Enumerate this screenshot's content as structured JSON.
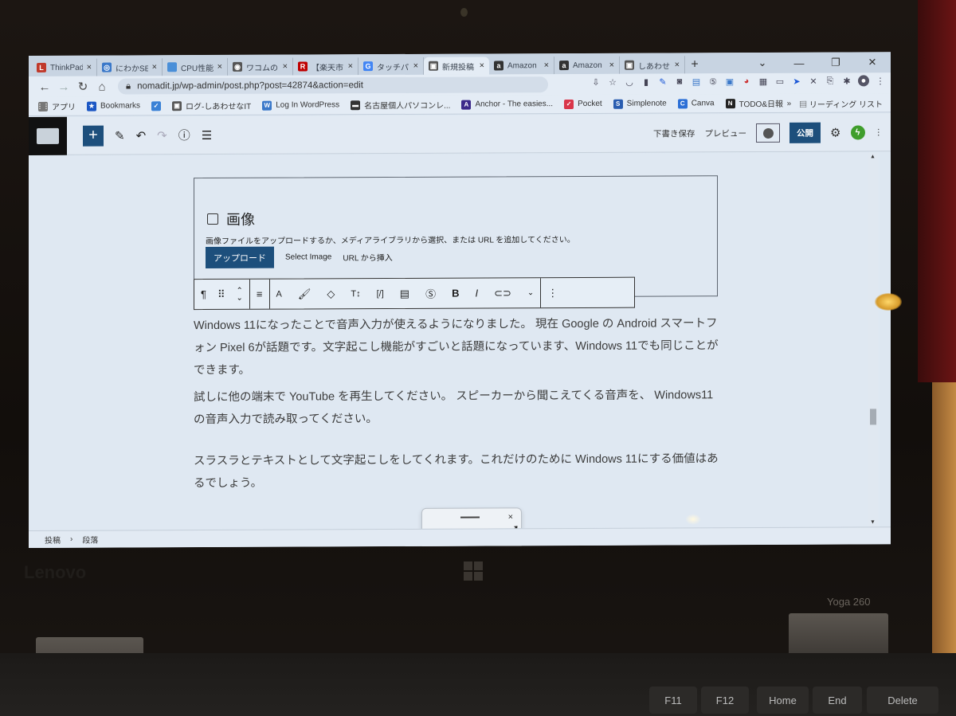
{
  "browser": {
    "tabs": [
      {
        "label": "ThinkPad",
        "icon": "lenovo-icon",
        "color": "#c0392b",
        "glyph": "L"
      },
      {
        "label": "にわかSE",
        "icon": "cloud-icon",
        "color": "#3a78c9",
        "glyph": "◎"
      },
      {
        "label": "CPU性能",
        "icon": "page-icon",
        "color": "#4a8fd8",
        "glyph": ""
      },
      {
        "label": "ワコムのア",
        "icon": "globe-icon",
        "color": "#555",
        "glyph": "◉"
      },
      {
        "label": "【楽天市",
        "icon": "rakuten-icon",
        "color": "#bf0000",
        "glyph": "R"
      },
      {
        "label": "タッチパッ",
        "icon": "google-icon",
        "color": "#4285f4",
        "glyph": "G"
      },
      {
        "label": "新規投稿",
        "icon": "site-icon",
        "color": "#555",
        "glyph": "▣",
        "active": true
      },
      {
        "label": "Amazon",
        "icon": "amazon-icon",
        "color": "#333",
        "glyph": "a"
      },
      {
        "label": "Amazon",
        "icon": "amazon-icon",
        "color": "#333",
        "glyph": "a"
      },
      {
        "label": "しあわせ",
        "icon": "site-icon",
        "color": "#555",
        "glyph": "▣"
      }
    ],
    "tab_close": "×",
    "new_tab": "+",
    "window_controls": [
      "⌄",
      "—",
      "❐",
      "✕"
    ],
    "url": "nomadit.jp/wp-admin/post.php?post=42874&action=edit",
    "bookmarks": [
      {
        "label": "アプリ",
        "icon": "apps-icon",
        "color": "#777",
        "glyph": "⋮⋮"
      },
      {
        "label": "Bookmarks",
        "icon": "star-icon",
        "color": "#1a56c4",
        "glyph": "★"
      },
      {
        "label": "",
        "icon": "twitter-icon",
        "color": "#3b82d6",
        "glyph": "✓"
      },
      {
        "label": "ログ-しあわせなIT",
        "icon": "site-icon",
        "color": "#555",
        "glyph": "▣"
      },
      {
        "label": "Log In WordPress",
        "icon": "wordpress-icon",
        "color": "#3a78c9",
        "glyph": "W"
      },
      {
        "label": "名古屋個人パソコンレ...",
        "icon": "monitor-icon",
        "color": "#333",
        "glyph": "▬"
      },
      {
        "label": "Anchor - The easies...",
        "icon": "anchor-icon",
        "color": "#3d2a8a",
        "glyph": "A"
      },
      {
        "label": "Pocket",
        "icon": "pocket-icon",
        "color": "#d9364a",
        "glyph": "✓"
      },
      {
        "label": "Simplenote",
        "icon": "simplenote-icon",
        "color": "#2a5db0",
        "glyph": "S"
      },
      {
        "label": "Canva",
        "icon": "canva-icon",
        "color": "#2b6fd6",
        "glyph": "C"
      },
      {
        "label": "TODO&日報",
        "icon": "notion-icon",
        "color": "#222",
        "glyph": "N"
      }
    ],
    "more_bookmarks": "»",
    "reading_list": "リーディング リスト"
  },
  "wp_toolbar": {
    "save_draft": "下書き保存",
    "preview": "プレビュー",
    "publish": "公開",
    "avatar": "ϟ"
  },
  "image_block": {
    "title": "画像",
    "description": "画像ファイルをアップロードするか、メディアライブラリから選択、または URL を追加してください。",
    "upload": "アップロード",
    "select_image": "Select Image",
    "insert_url": "URL から挿入"
  },
  "paragraphs": [
    "Windows 11になったことで音声入力が使えるようになりました。 現在 Google の Android スマートフォン Pixel 6が話題です。文字起こし機能がすごいと話題になっています、Windows 11でも同じことができます。",
    "試しに他の端末で YouTube を再生してください。 スピーカーから聞こえてくる音声を、 Windows11の音声入力で読み取ってください。",
    "スラスラとテキストとして文字起こしをしてくれます。これだけのために Windows 11にする価値はあるでしょう。"
  ],
  "breadcrumb": {
    "items": [
      "投稿",
      "段落"
    ],
    "separator": "›"
  },
  "voice_typing": {
    "close": "×"
  },
  "device": {
    "brand": "Lenovo",
    "model": "Yoga 260",
    "keys": [
      "F11",
      "F12",
      "Home",
      "End",
      "Delete"
    ]
  }
}
